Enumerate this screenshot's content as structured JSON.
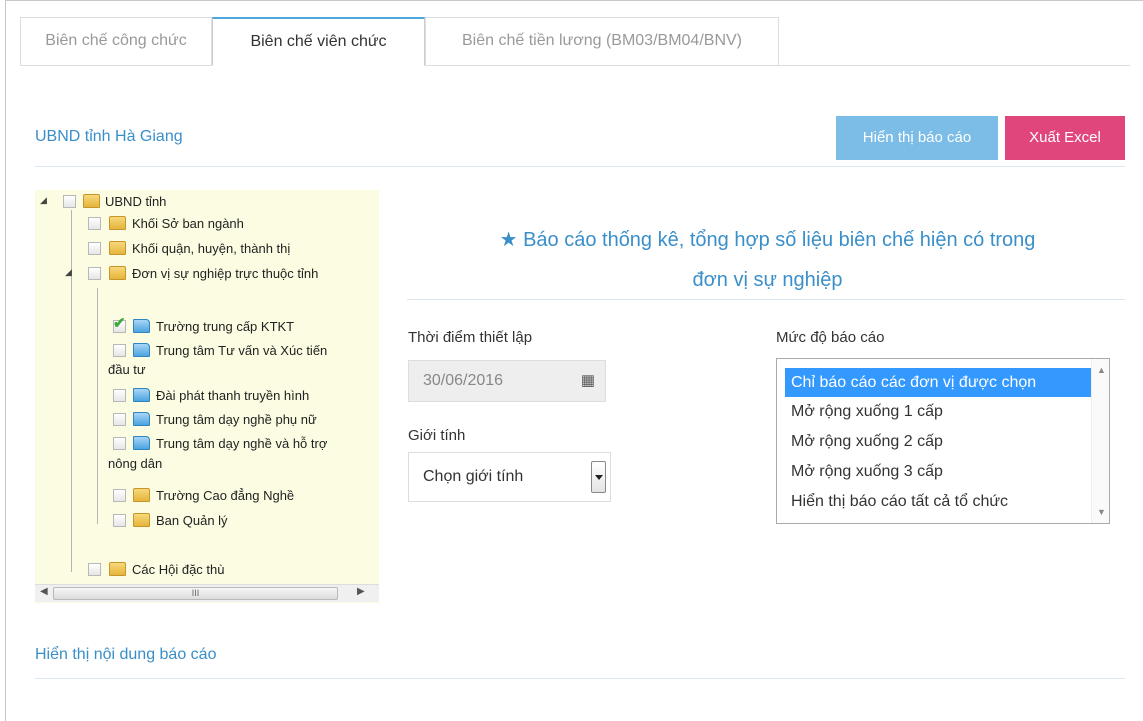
{
  "tabs": [
    {
      "label": "Biên chế công chức"
    },
    {
      "label": "Biên chế viên chức"
    },
    {
      "label": "Biên chế tiền lương (BM03/BM04/BNV)"
    }
  ],
  "org_title": "UBND tỉnh Hà Giang",
  "buttons": {
    "show_report": "Hiển thị báo cáo",
    "export_excel": "Xuất Excel"
  },
  "tree": {
    "root": "UBND tỉnh",
    "n1": "Khối Sở ban ngành",
    "n2": "Khối quận, huyện, thành thị",
    "n3": "Đơn vị sự nghiệp trực thuộc tỉnh",
    "c1": "Trường trung cấp KTKT",
    "c2a": "Trung tâm Tư vấn và Xúc tiến",
    "c2b": "đầu tư",
    "c3": "Đài phát thanh truyền hình",
    "c4": "Trung tâm dạy nghề phụ nữ",
    "c5a": "Trung tâm dạy nghề và hỗ trợ",
    "c5b": "nông dân",
    "c6": "Trường Cao đẳng Nghề",
    "c7": "Ban Quản lý",
    "n4": "Các Hội đặc thù",
    "scroll_glyph": "III"
  },
  "report_heading": {
    "line1": "Báo cáo thống kê, tổng hợp số liệu biên chế hiện có trong",
    "line2": "đơn vị sự nghiệp"
  },
  "form": {
    "date_label": "Thời điểm thiết lập",
    "date_value": "30/06/2016",
    "gender_label": "Giới tính",
    "gender_value": "Chọn giới tính",
    "level_label": "Mức độ báo cáo",
    "level_options": [
      "Chỉ báo cáo các đơn vị được chọn",
      "Mở rộng xuống 1 cấp",
      "Mở rộng xuống 2 cấp",
      "Mở rộng xuống 3 cấp",
      "Hiển thị báo cáo tất cả tổ chức"
    ]
  },
  "content_title": "Hiển thị nội dung báo cáo",
  "colors": {
    "accent": "#3a8fc9",
    "show_btn": "#7bbde7",
    "excel_btn": "#e0457c",
    "selected": "#3399ff"
  }
}
